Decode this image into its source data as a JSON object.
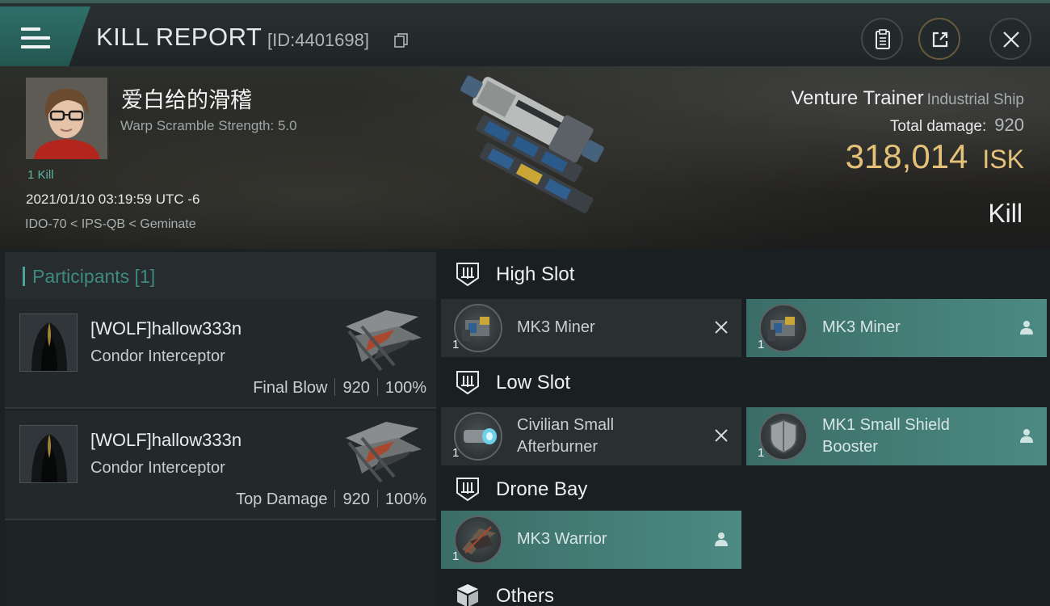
{
  "header": {
    "title": "KILL REPORT",
    "report_id": "[ID:4401698]"
  },
  "victim": {
    "name": "爱白给的滑稽",
    "warp_scramble": "Warp Scramble Strength: 5.0",
    "kills": "1 Kill",
    "datetime": "2021/01/10 03:19:59 UTC -6",
    "location": "IDO-70 < IPS-QB < Geminate"
  },
  "ship": {
    "name": "Venture Trainer",
    "class": "Industrial Ship",
    "total_damage_label": "Total damage:",
    "total_damage": "920",
    "isk_value": "318,014",
    "isk_unit": "ISK",
    "kill_type": "Kill"
  },
  "participants": {
    "header": "Participants [1]",
    "items": [
      {
        "name": "[WOLF]hallow333n",
        "ship": "Condor Interceptor",
        "role": "Final Blow",
        "damage": "920",
        "percent": "100%"
      },
      {
        "name": "[WOLF]hallow333n",
        "ship": "Condor Interceptor",
        "role": "Top Damage",
        "damage": "920",
        "percent": "100%"
      }
    ]
  },
  "fitting": {
    "high_slot": {
      "label": "High Slot",
      "items": [
        {
          "name": "MK3 Miner",
          "qty": "1",
          "status": "destroyed"
        },
        {
          "name": "MK3 Miner",
          "qty": "1",
          "status": "dropped"
        }
      ]
    },
    "low_slot": {
      "label": "Low Slot",
      "items": [
        {
          "name_line1": "Civilian Small",
          "name_line2": "Afterburner",
          "qty": "1",
          "status": "destroyed"
        },
        {
          "name_line1": "MK1 Small Shield",
          "name_line2": "Booster",
          "qty": "1",
          "status": "dropped"
        }
      ]
    },
    "drone_bay": {
      "label": "Drone Bay",
      "items": [
        {
          "name": "MK3  Warrior",
          "qty": "1",
          "status": "dropped"
        }
      ]
    },
    "others": {
      "label": "Others"
    }
  },
  "colors": {
    "accent_teal": "#4c8a83",
    "isk_gold": "#e4c27a",
    "kills_teal": "#5fb3a8"
  },
  "icons": {
    "menu": "hamburger-icon",
    "copy": "copy-icon",
    "clipboard": "clipboard-icon",
    "share": "share-icon",
    "close": "close-icon",
    "slot": "module-slot-icon",
    "others": "cube-icon",
    "destroyed": "x-icon",
    "dropped": "person-icon"
  }
}
